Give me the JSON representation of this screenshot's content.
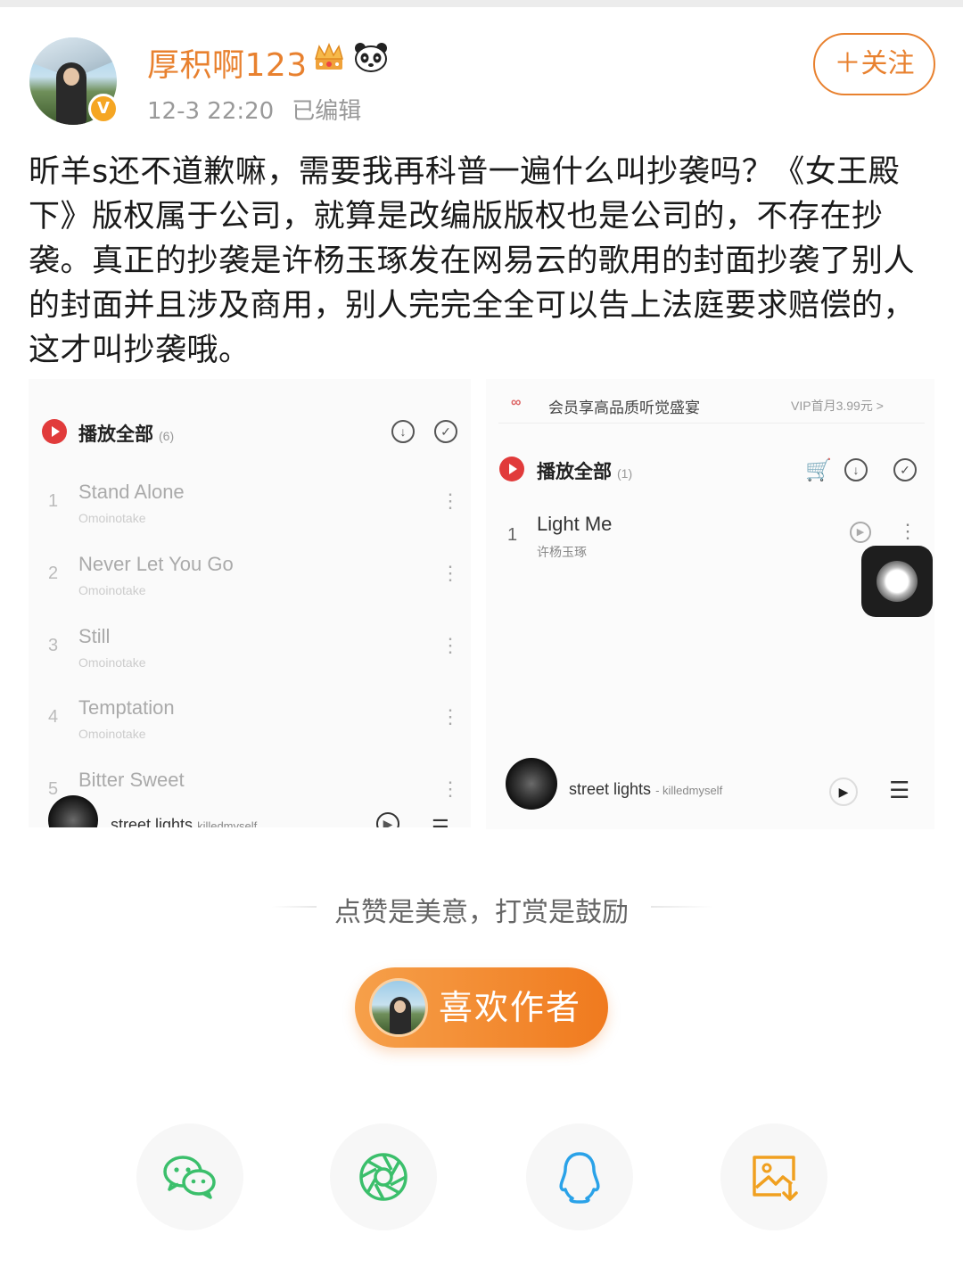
{
  "post": {
    "author": "厚积啊123",
    "time": "12-3 22:20",
    "edited": "已编辑",
    "follow_label": "＋关注",
    "text": "昕羊s还不道歉嘛，需要我再科普一遍什么叫抄袭吗？《女王殿下》版权属于公司，就算是改编版版权也是公司的，不存在抄袭。真正的抄袭是许杨玉琢发在网易云的歌用的封面抄袭了别人的封面并且涉及商用，别人完完全全可以告上法庭要求赔偿的，这才叫抄袭哦。"
  },
  "left_shot": {
    "play_all": "播放全部",
    "count": "(6)",
    "songs": [
      {
        "num": "1",
        "title": "Stand Alone",
        "artist": "Omoinotake"
      },
      {
        "num": "2",
        "title": "Never Let You Go",
        "artist": "Omoinotake"
      },
      {
        "num": "3",
        "title": "Still",
        "artist": "Omoinotake"
      },
      {
        "num": "4",
        "title": "Temptation",
        "artist": "Omoinotake"
      },
      {
        "num": "5",
        "title": "Bitter Sweet",
        "artist": ""
      }
    ],
    "now_playing": "street lights",
    "now_playing_artist": "killedmyself"
  },
  "right_shot": {
    "vip_logo": "∞",
    "vip_text": "会员享高品质听觉盛宴",
    "vip_price": "VIP首月3.99元 >",
    "play_all": "播放全部",
    "count": "(1)",
    "song": {
      "num": "1",
      "title": "Light Me",
      "artist": "许杨玉琢"
    },
    "now_playing": "street lights",
    "now_playing_artist": "- killedmyself"
  },
  "reward": {
    "slogan": "点赞是美意，打赏是鼓励",
    "like_author": "喜欢作者"
  },
  "share": [
    {
      "icon": "wechat-icon",
      "color": "#3bbf6b"
    },
    {
      "icon": "moments-icon",
      "color": "#3bbf6b"
    },
    {
      "icon": "qq-icon",
      "color": "#2aa2e8"
    },
    {
      "icon": "save-image-icon",
      "color": "#f0a020"
    }
  ]
}
